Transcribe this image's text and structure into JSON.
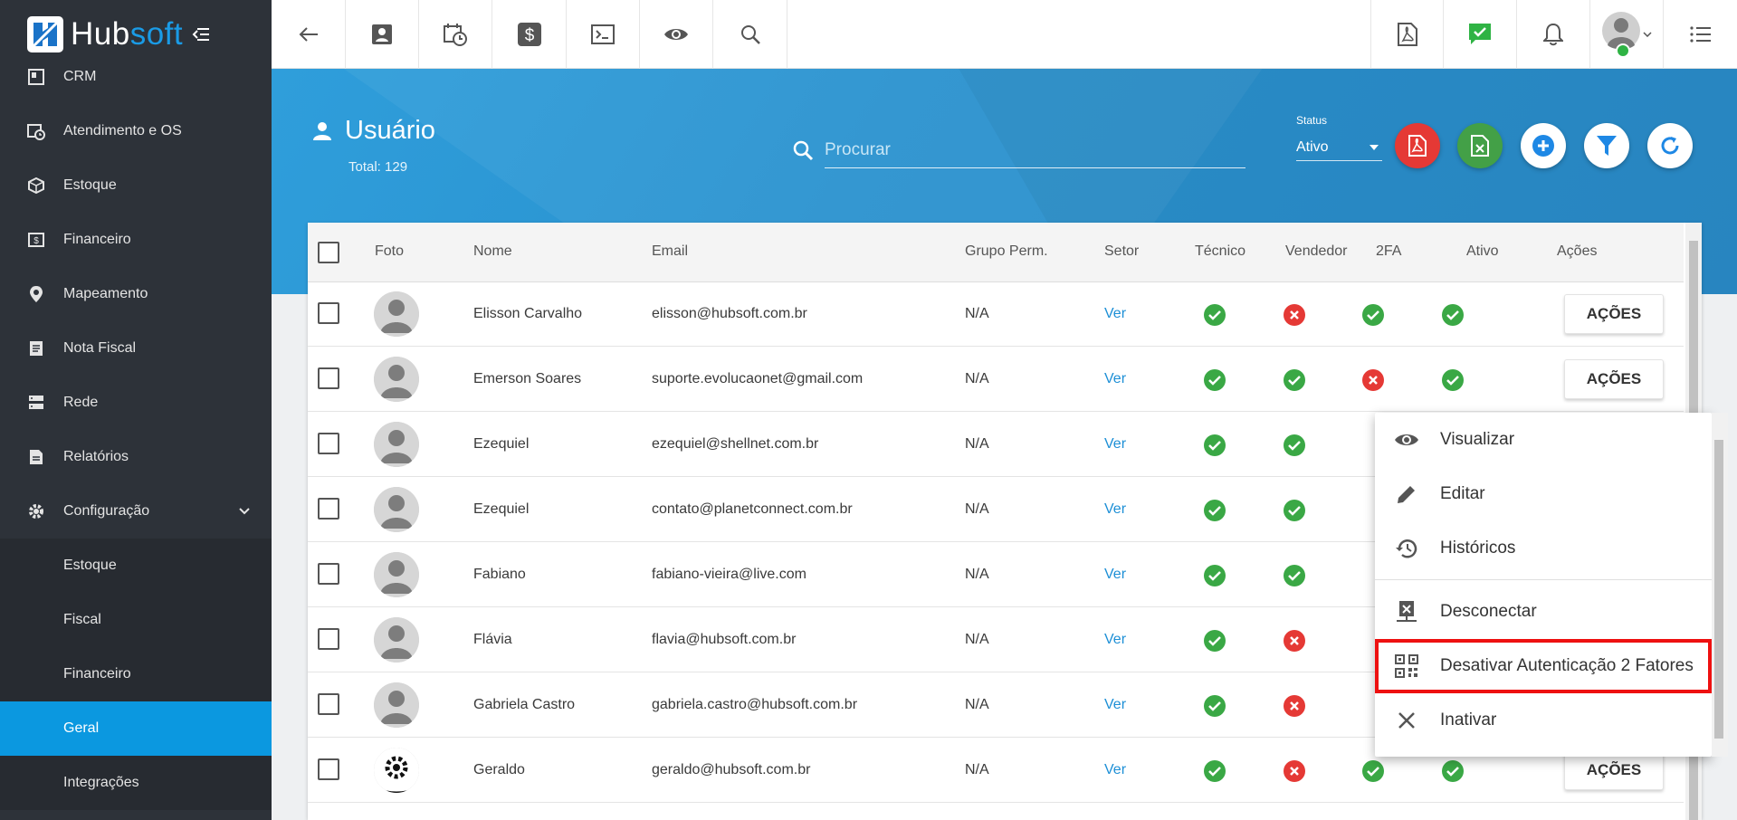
{
  "app": {
    "brand_part1": "Hub",
    "brand_part2": "soft",
    "accent": "#0b98e0"
  },
  "sidebar": {
    "items": [
      {
        "label": "CRM",
        "icon": "crm-icon"
      },
      {
        "label": "Atendimento e OS",
        "icon": "calendar-clock-icon"
      },
      {
        "label": "Estoque",
        "icon": "box-icon"
      },
      {
        "label": "Financeiro",
        "icon": "money-icon"
      },
      {
        "label": "Mapeamento",
        "icon": "map-pin-icon"
      },
      {
        "label": "Nota Fiscal",
        "icon": "document-icon"
      },
      {
        "label": "Rede",
        "icon": "server-icon"
      },
      {
        "label": "Relatórios",
        "icon": "report-icon"
      },
      {
        "label": "Configuração",
        "icon": "gear-icon"
      }
    ],
    "subitems": [
      {
        "label": "Estoque"
      },
      {
        "label": "Fiscal"
      },
      {
        "label": "Financeiro"
      },
      {
        "label": "Geral"
      },
      {
        "label": "Integrações"
      }
    ]
  },
  "topbar": {
    "left_icons": [
      "back-arrow-icon",
      "contact-card-icon",
      "calendar-clock-icon",
      "dollar-icon",
      "terminal-icon",
      "eye-icon",
      "search-icon"
    ],
    "right_icons": [
      "pdf-icon",
      "check-chat-icon",
      "bell-icon",
      "avatar",
      "list-icon"
    ]
  },
  "header": {
    "title": "Usuário",
    "total": "Total: 129",
    "search_placeholder": "Procurar",
    "status_label": "Status",
    "status_value": "Ativo"
  },
  "table": {
    "columns": [
      "Foto",
      "Nome",
      "Email",
      "Grupo Perm.",
      "Setor",
      "Técnico",
      "Vendedor",
      "2FA",
      "Ativo",
      "Ações"
    ],
    "action_label": "AÇÕES",
    "rows": [
      {
        "nome": "Elisson Carvalho",
        "email": "elisson@hubsoft.com.br",
        "grupo": "N/A",
        "setor": "Ver",
        "tecnico": true,
        "vendedor": false,
        "twofa": true,
        "ativo": true,
        "show_actions": true
      },
      {
        "nome": "Emerson Soares",
        "email": "suporte.evolucaonet@gmail.com",
        "grupo": "N/A",
        "setor": "Ver",
        "tecnico": true,
        "vendedor": true,
        "twofa": false,
        "ativo": true,
        "show_actions": true
      },
      {
        "nome": "Ezequiel",
        "email": "ezequiel@shellnet.com.br",
        "grupo": "N/A",
        "setor": "Ver",
        "tecnico": true,
        "vendedor": true,
        "twofa": null,
        "ativo": null,
        "show_actions": false
      },
      {
        "nome": "Ezequiel",
        "email": "contato@planetconnect.com.br",
        "grupo": "N/A",
        "setor": "Ver",
        "tecnico": true,
        "vendedor": true,
        "twofa": null,
        "ativo": null,
        "show_actions": false
      },
      {
        "nome": "Fabiano",
        "email": "fabiano-vieira@live.com",
        "grupo": "N/A",
        "setor": "Ver",
        "tecnico": true,
        "vendedor": true,
        "twofa": null,
        "ativo": null,
        "show_actions": false
      },
      {
        "nome": "Flávia",
        "email": "flavia@hubsoft.com.br",
        "grupo": "N/A",
        "setor": "Ver",
        "tecnico": true,
        "vendedor": false,
        "twofa": null,
        "ativo": null,
        "show_actions": false
      },
      {
        "nome": "Gabriela Castro",
        "email": "gabriela.castro@hubsoft.com.br",
        "grupo": "N/A",
        "setor": "Ver",
        "tecnico": true,
        "vendedor": false,
        "twofa": null,
        "ativo": null,
        "show_actions": false
      },
      {
        "nome": "Geraldo",
        "email": "geraldo@hubsoft.com.br",
        "grupo": "N/A",
        "setor": "Ver",
        "tecnico": true,
        "vendedor": false,
        "twofa": true,
        "ativo": true,
        "show_actions": true
      }
    ]
  },
  "actions_menu": {
    "items": [
      {
        "label": "Visualizar",
        "icon": "eye-icon"
      },
      {
        "label": "Editar",
        "icon": "pencil-icon"
      },
      {
        "label": "Históricos",
        "icon": "history-icon"
      },
      {
        "label": "Desconectar",
        "icon": "disconnect-icon"
      },
      {
        "label": "Desativar Autenticação 2 Fatores",
        "icon": "qr-code-icon",
        "highlighted": true
      },
      {
        "label": "Inativar",
        "icon": "close-icon"
      }
    ]
  },
  "colors": {
    "ok": "#3aa845",
    "no": "#e53935",
    "header_band": "#2a92cf",
    "highlight_border": "#ee1111"
  }
}
